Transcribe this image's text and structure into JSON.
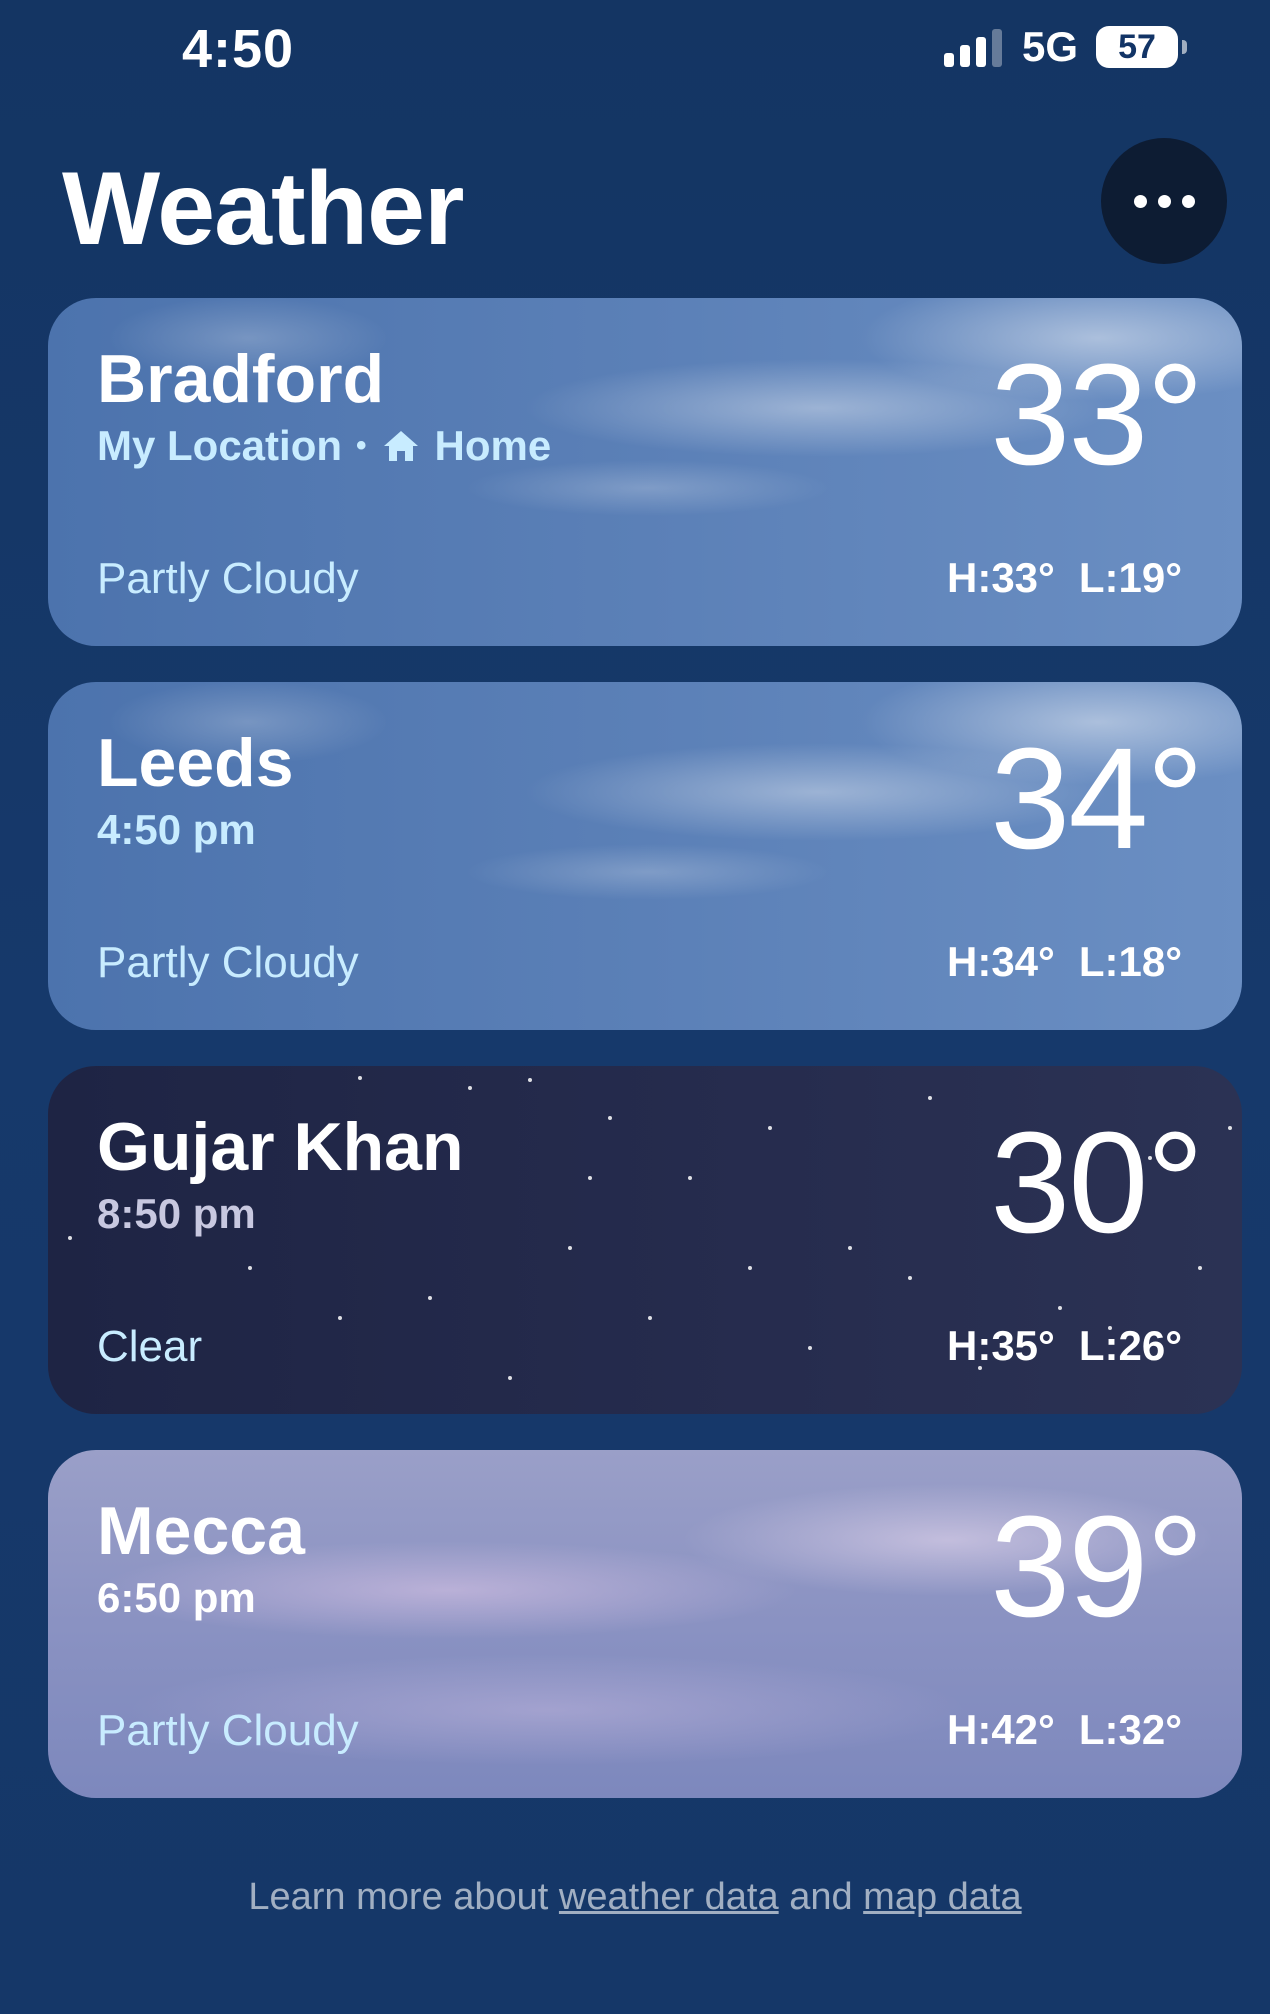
{
  "status_bar": {
    "time": "4:50",
    "network": "5G",
    "battery": "57"
  },
  "header": {
    "title": "Weather",
    "more_icon": "ellipsis-icon"
  },
  "cards": [
    {
      "city": "Bradford",
      "sub_primary": "My Location",
      "sub_secondary": "Home",
      "temp": "33°",
      "condition": "Partly Cloudy",
      "high": "H:33°",
      "low": "L:19°"
    },
    {
      "city": "Leeds",
      "sub_primary": "4:50 pm",
      "temp": "34°",
      "condition": "Partly Cloudy",
      "high": "H:34°",
      "low": "L:18°"
    },
    {
      "city": "Gujar Khan",
      "sub_primary": "8:50 pm",
      "temp": "30°",
      "condition": "Clear",
      "high": "H:35°",
      "low": "L:26°"
    },
    {
      "city": "Mecca",
      "sub_primary": "6:50 pm",
      "temp": "39°",
      "condition": "Partly Cloudy",
      "high": "H:42°",
      "low": "L:32°"
    }
  ],
  "footer": {
    "prefix": "Learn more about",
    "link1": "weather data",
    "middle": "and",
    "link2": "map data"
  }
}
